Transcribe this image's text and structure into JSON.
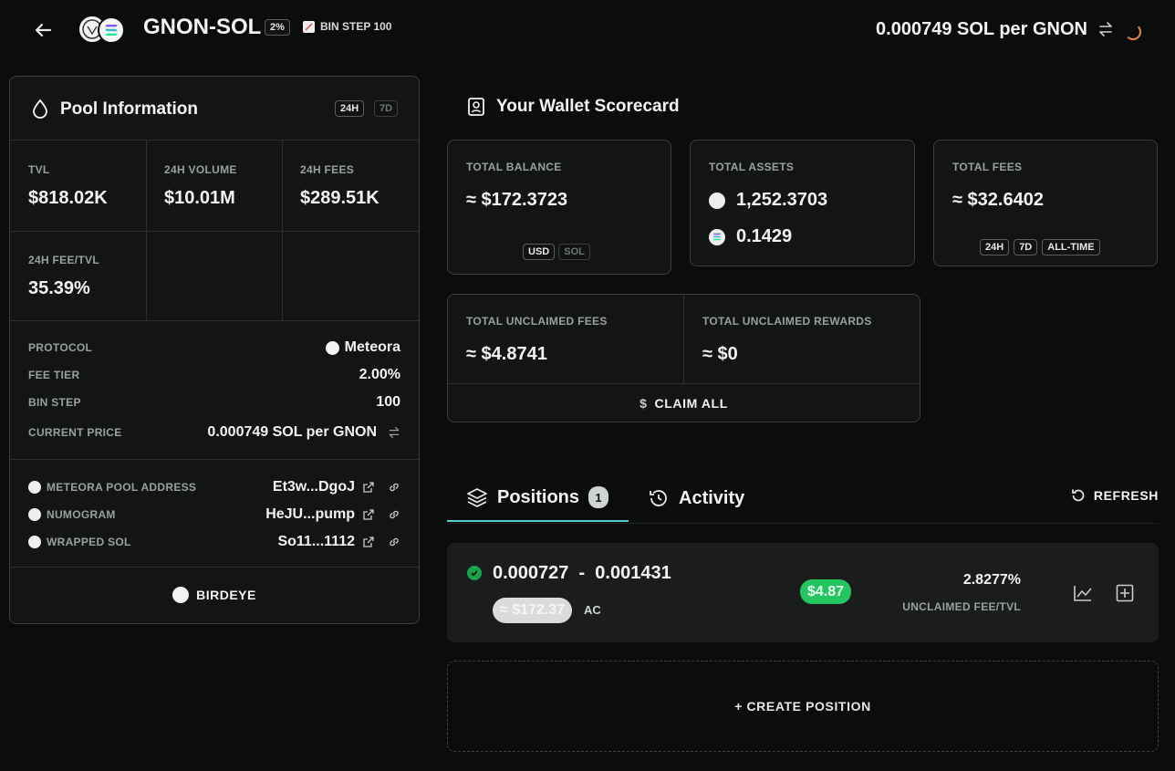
{
  "header": {
    "pair": "GNON-SOL",
    "fee_badge": "2%",
    "bin_step": "BIN STEP 100",
    "price": "0.000749 SOL per GNON"
  },
  "pool_info": {
    "title": "Pool Information",
    "range_24h": "24H",
    "range_7d": "7D",
    "stats": [
      {
        "label": "TVL",
        "value": "$818.02K"
      },
      {
        "label": "24H VOLUME",
        "value": "$10.01M"
      },
      {
        "label": "24H FEES",
        "value": "$289.51K"
      },
      {
        "label": "24H FEE/TVL",
        "value": "35.39%"
      }
    ],
    "details": [
      {
        "label": "PROTOCOL",
        "value": "Meteora"
      },
      {
        "label": "FEE TIER",
        "value": "2.00%"
      },
      {
        "label": "BIN STEP",
        "value": "100"
      },
      {
        "label": "CURRENT PRICE",
        "value": "0.000749 SOL per GNON"
      }
    ],
    "addresses": [
      {
        "label": "METEORA POOL ADDRESS",
        "value": "Et3w...DgoJ"
      },
      {
        "label": "NUMOGRAM",
        "value": "HeJU...pump"
      },
      {
        "label": "WRAPPED SOL",
        "value": "So11...1112"
      }
    ],
    "birdeye": "BIRDEYE"
  },
  "scorecard": {
    "title": "Your Wallet Scorecard",
    "total_balance": {
      "label": "TOTAL BALANCE",
      "value": "≈ $172.3723",
      "usd": "USD",
      "sol": "SOL"
    },
    "total_assets": {
      "label": "TOTAL ASSETS",
      "gnon": "1,252.3703",
      "sol": "0.1429"
    },
    "total_fees": {
      "label": "TOTAL FEES",
      "value": "≈ $32.6402",
      "opts": [
        "24H",
        "7D",
        "ALL-TIME"
      ]
    },
    "unclaimed_fees": {
      "label": "TOTAL UNCLAIMED FEES",
      "value": "≈ $4.8741"
    },
    "unclaimed_rewards": {
      "label": "TOTAL UNCLAIMED REWARDS",
      "value": "≈ $0"
    },
    "claim_all": "CLAIM ALL"
  },
  "tabs": {
    "positions": "Positions",
    "positions_count": "1",
    "activity": "Activity",
    "refresh": "REFRESH"
  },
  "position": {
    "range": "0.000727  -  0.001431",
    "usd": "≈ $172.37",
    "tag": "AC",
    "unclaimed": "$4.87",
    "fee_tvl": "2.8277%",
    "fee_tvl_label": "UNCLAIMED FEE/TVL"
  },
  "create_position": "+ CREATE POSITION",
  "colors": {
    "background": "#0b0d0c",
    "accent_tab": "#4fd1c5",
    "green": "#22c55e",
    "spinner": "#e8873a"
  }
}
